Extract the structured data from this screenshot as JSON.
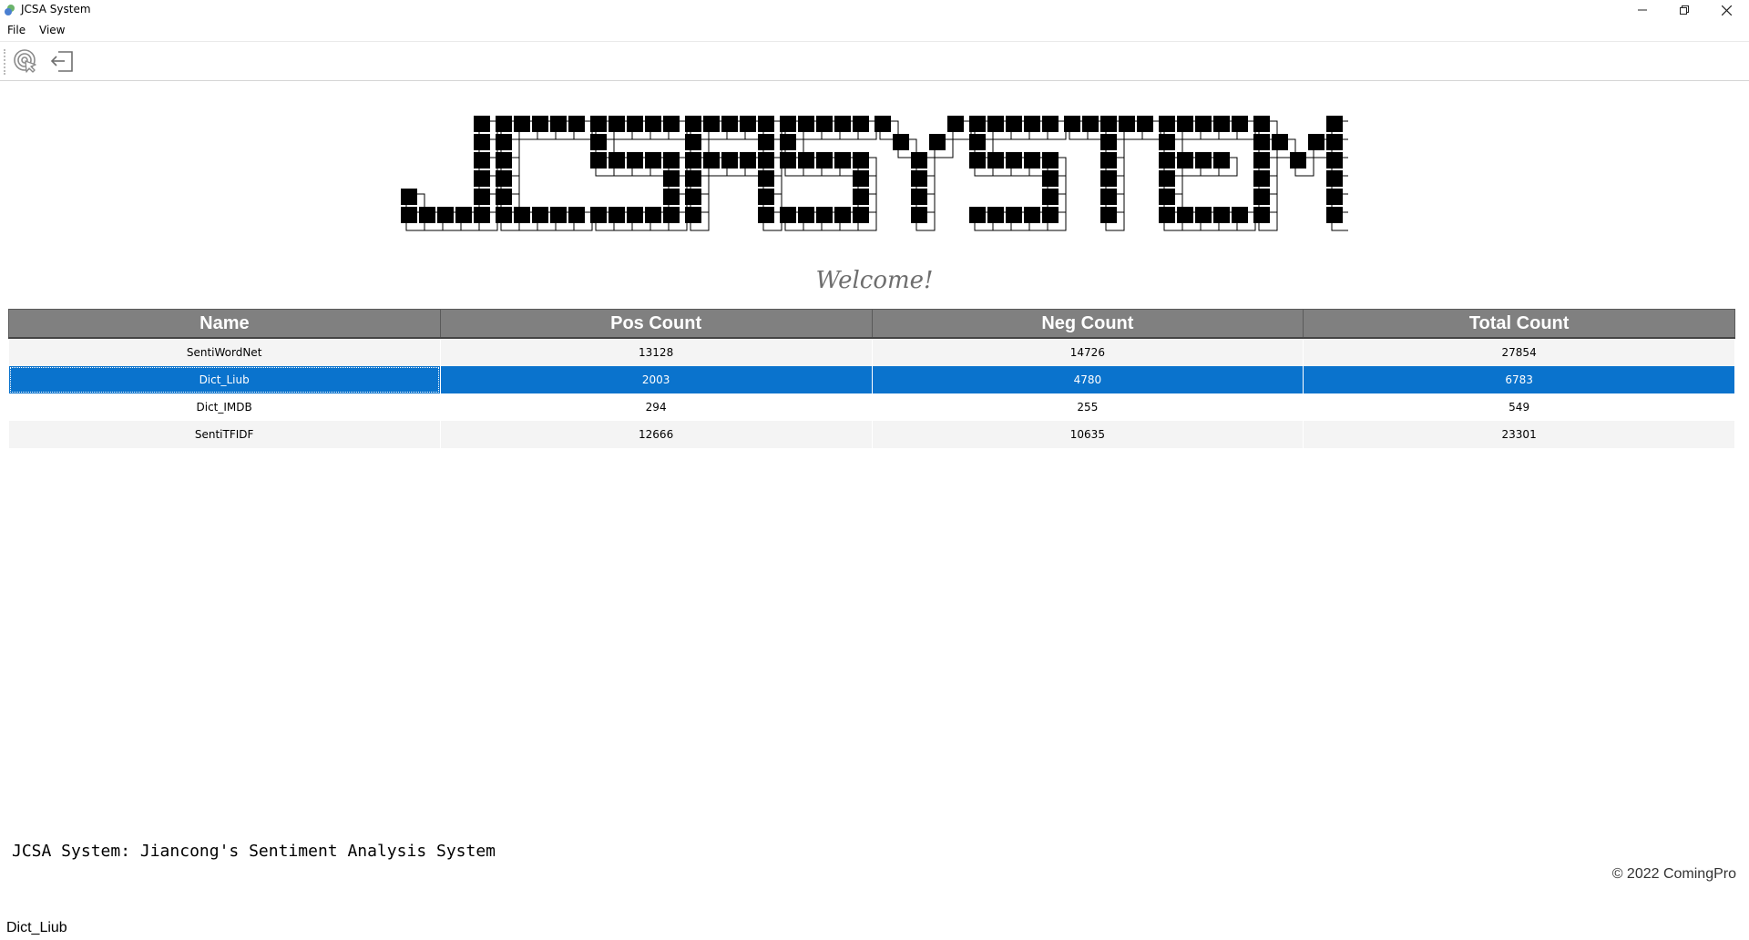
{
  "window": {
    "title": "JCSA System",
    "controls": [
      "minimize-icon",
      "restore-icon",
      "close-icon"
    ]
  },
  "menu": [
    "File",
    "View"
  ],
  "toolbar": {
    "buttons": [
      {
        "icon": "click-target-icon"
      },
      {
        "icon": "exit-icon"
      }
    ]
  },
  "banner": {
    "text": "JCSASYSTEM"
  },
  "welcome": "Welcome!",
  "table": {
    "columns": [
      "Name",
      "Pos Count",
      "Neg Count",
      "Total Count"
    ],
    "rows": [
      [
        "SentiWordNet",
        "13128",
        "14726",
        "27854"
      ],
      [
        "Dict_Liub",
        "2003",
        "4780",
        "6783"
      ],
      [
        "Dict_IMDB",
        "294",
        "255",
        "549"
      ],
      [
        "SentiTFIDF",
        "12666",
        "10635",
        "23301"
      ]
    ],
    "selected_row": "Dict_Liub",
    "header_color": "#808080",
    "selection_color": "#0a73cd"
  },
  "footer": {
    "description": "JCSA System: Jiancong's Sentiment Analysis System",
    "copyright": "© 2022 ComingPro"
  },
  "status": "Dict_Liub"
}
